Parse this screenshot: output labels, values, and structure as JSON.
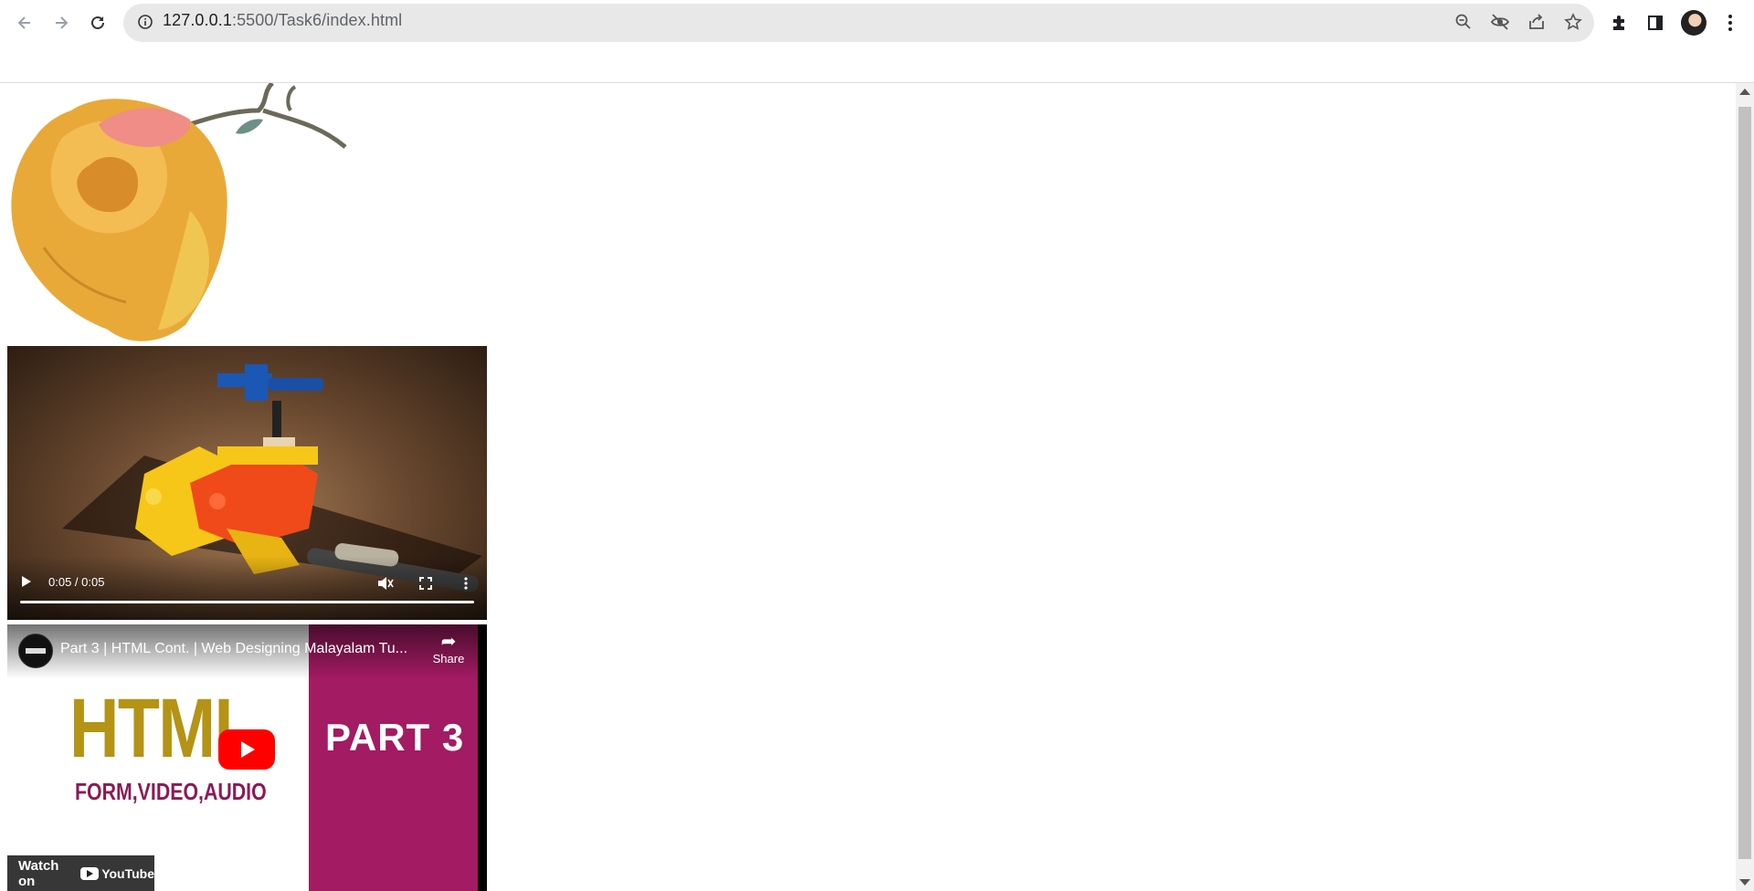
{
  "browser": {
    "url_host": "127.0.0.1",
    "url_rest": ":5500/Task6/index.html"
  },
  "video": {
    "time": "0:05 / 0:05",
    "progress_fraction": 1.0
  },
  "youtube": {
    "title": "Part 3 | HTML Cont. | Web Designing Malayalam Tu...",
    "share_label": "Share",
    "thumb_main": "HTML",
    "thumb_sub": "FORM,VIDEO,AUDIO",
    "thumb_part": "PART 3",
    "watch_on": "Watch on",
    "yt_brand": "YouTube"
  },
  "colors": {
    "thumb_magenta": "#a21b63",
    "thumb_gold": "#b49315",
    "yt_red": "#ff0000"
  }
}
